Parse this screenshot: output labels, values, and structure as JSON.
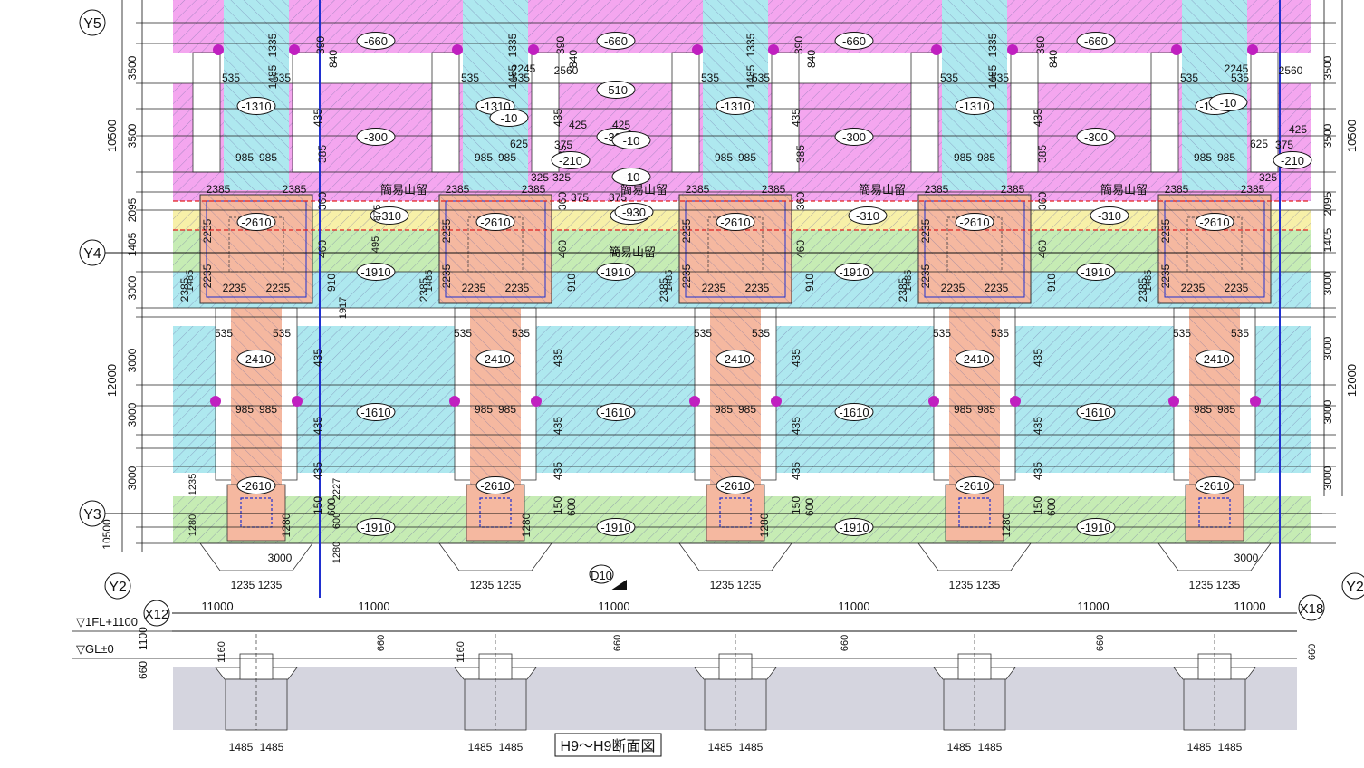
{
  "grid": {
    "rows": [
      "Y5",
      "Y4",
      "Y3",
      "Y2"
    ],
    "cols": [
      "X12",
      "X18"
    ]
  },
  "dims": {
    "left_chain": [
      "3500",
      "3500",
      "2095",
      "1405",
      "3000",
      "3000",
      "3000",
      "3000",
      "10500"
    ],
    "left_totals": [
      "10500",
      "12000"
    ],
    "right_chain": [
      "3500",
      "3500",
      "2095",
      "1405",
      "3000",
      "3000",
      "3000",
      "3000"
    ],
    "right_totals": [
      "10500",
      "12000"
    ],
    "spans": [
      "11000",
      "11000",
      "11000",
      "11000",
      "11000",
      "11000"
    ]
  },
  "levels": [
    {
      "label": "▽1FL+1100",
      "dim": "1100"
    },
    {
      "label": "▽GL±0",
      "dim": "660"
    }
  ],
  "elevations": {
    "pit_top": "-660",
    "pit_a": "-510",
    "pit_b": "-300",
    "pit_c": "-10",
    "pit_d": "-210",
    "pit_e": "-310",
    "pit_f": "-930",
    "col_top": "-1310",
    "col_mid": "-2410",
    "col_base": "-2610",
    "band_green": "-1910",
    "band_cyan": "-1610"
  },
  "labels": {
    "retaining": "簡易山留",
    "callout": "D10",
    "section_title": "H9～H9断面図"
  },
  "numbers": {
    "n985": "985",
    "n535": "535",
    "n2235": "2235",
    "n2385": "2385",
    "n1235": "1235",
    "n1485": "1485",
    "n3000": "3000",
    "n435": "435",
    "n460": "460",
    "n910": "910",
    "n1280": "1280",
    "n150": "150",
    "n600": "600",
    "n1160": "1160",
    "n660": "660",
    "n1335": "1335",
    "n390": "390",
    "n840": "840",
    "n2245": "2245",
    "n2560": "2560",
    "n425": "425",
    "n375": "375",
    "n625": "625",
    "n325": "325",
    "n360": "360",
    "n385": "385",
    "n1917": "1917",
    "n2227": "2227",
    "n495": "495",
    "n875": "875"
  },
  "colors": {
    "magenta": "#f4a6ef",
    "cyan": "#aee8ef",
    "salmon": "#f5b8a0",
    "green": "#c6ecb4",
    "yellow": "#f7f0a8",
    "white": "#ffffff",
    "ground": "#d5d5df",
    "redline": "#e02020",
    "blueline": "#2030d0",
    "hatch": "#6a6aa0"
  }
}
